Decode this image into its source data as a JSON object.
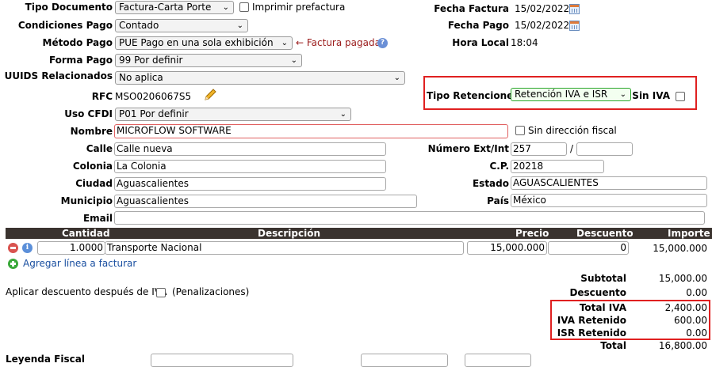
{
  "form": {
    "tipo_documento": {
      "label": "Tipo Documento",
      "value": "Factura-Carta Porte"
    },
    "imprimir_prefactura": {
      "label": "Imprimir prefactura",
      "checked": false
    },
    "condiciones_pago": {
      "label": "Condiciones Pago",
      "value": "Contado"
    },
    "metodo_pago": {
      "label": "Método Pago",
      "value": "PUE Pago en una sola exhibición",
      "note": "← Factura pagada",
      "help_icon": "question-circle-icon"
    },
    "forma_pago": {
      "label": "Forma Pago",
      "value": "99 Por definir"
    },
    "uuids": {
      "label": "UUIDS Relacionados",
      "value": "No aplica"
    },
    "rfc": {
      "label": "RFC",
      "value": "MSO0206067S5",
      "edit_icon": "pencil-icon"
    },
    "uso_cfdi": {
      "label": "Uso CFDI",
      "value": "P01 Por definir"
    },
    "nombre": {
      "label": "Nombre",
      "value": "MICROFLOW SOFTWARE"
    },
    "sin_direccion": {
      "label": "Sin dirección fiscal",
      "checked": false
    },
    "calle": {
      "label": "Calle",
      "value": "Calle nueva"
    },
    "colonia": {
      "label": "Colonia",
      "value": "La Colonia"
    },
    "ciudad": {
      "label": "Ciudad",
      "value": "Aguascalientes"
    },
    "municipio": {
      "label": "Municipio",
      "value": "Aguascalientes"
    },
    "email": {
      "label": "Email",
      "value": ""
    },
    "numero": {
      "label": "Número Ext/Int",
      "ext": "257",
      "sep": "/",
      "int": ""
    },
    "cp": {
      "label": "C.P.",
      "value": "20218"
    },
    "estado": {
      "label": "Estado",
      "value": "AGUASCALIENTES"
    },
    "pais": {
      "label": "País",
      "value": "México"
    },
    "fecha_factura": {
      "label": "Fecha Factura",
      "value": "15/02/2022"
    },
    "fecha_pago": {
      "label": "Fecha Pago",
      "value": "15/02/2022"
    },
    "hora_local": {
      "label": "Hora Local",
      "value": "18:04"
    },
    "tipo_retenciones": {
      "label": "Tipo Retenciones",
      "value": "Retención IVA e ISR",
      "accent": "#2aa52a"
    },
    "sin_iva": {
      "label": "Sin IVA",
      "checked": false
    }
  },
  "table": {
    "headers": {
      "cantidad": "Cantidad",
      "descripcion": "Descripción",
      "precio": "Precio",
      "descuento": "Descuento",
      "importe": "Importe"
    },
    "rows": [
      {
        "cantidad": "1.0000",
        "descripcion": "Transporte Nacional",
        "precio": "15,000.000",
        "descuento": "0",
        "importe": "15,000.000"
      }
    ],
    "add_line": "Agregar línea a facturar"
  },
  "descuento_iva": {
    "label": "Aplicar descuento después de IVA",
    "note": "(Penalizaciones)",
    "checked": false
  },
  "totals": {
    "subtotal": {
      "label": "Subtotal",
      "value": "15,000.00"
    },
    "descuento": {
      "label": "Descuento",
      "value": "0.00"
    },
    "total_iva": {
      "label": "Total IVA",
      "value": "2,400.00"
    },
    "iva_retenido": {
      "label": "IVA Retenido",
      "value": "600.00"
    },
    "isr_retenido": {
      "label": "ISR Retenido",
      "value": "0.00"
    },
    "total": {
      "label": "Total",
      "value": "16,800.00"
    }
  },
  "footer": {
    "leyenda": "Leyenda Fiscal"
  },
  "colors": {
    "highlight": "#e02020",
    "header_bg": "#3a332f",
    "note": "#9b1c1c"
  }
}
